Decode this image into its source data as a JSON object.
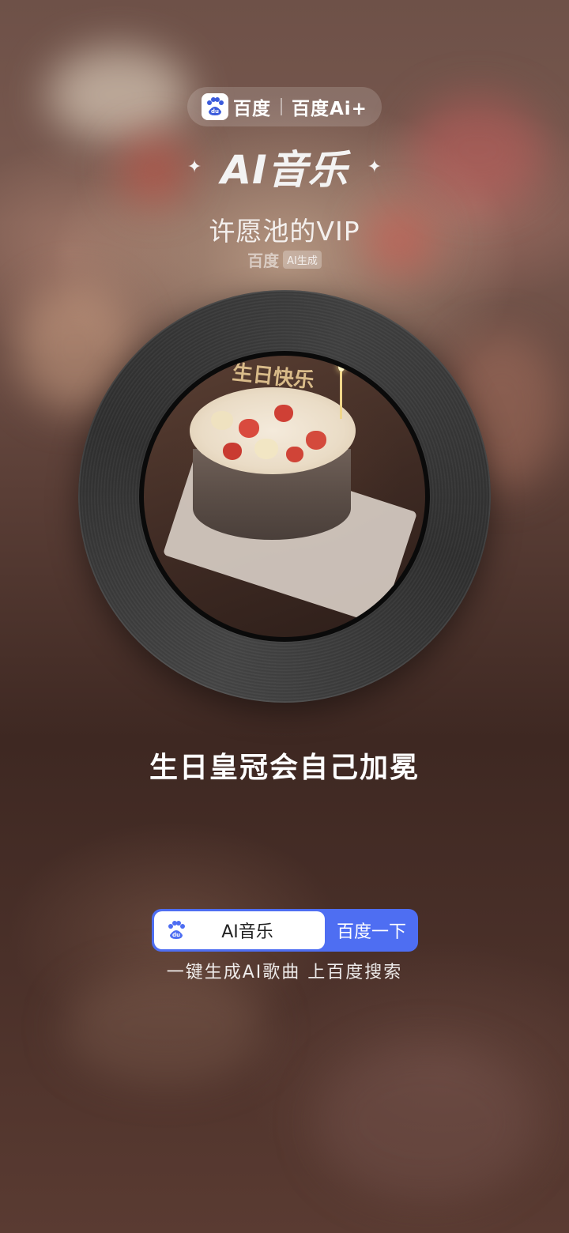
{
  "header": {
    "brand_name": "百度",
    "brand_ai": "百度Ai+",
    "logo_icon": "baidu-paw-icon"
  },
  "app": {
    "title": "AI音乐",
    "sparkle_left": "✦",
    "sparkle_right": "✦"
  },
  "song": {
    "title": "许愿池的VIP",
    "source_brand": "百度",
    "source_badge": "AI生成",
    "cover_script": "生日快乐"
  },
  "lyric": {
    "current_line": "生日皇冠会自己加冕"
  },
  "search": {
    "logo_icon": "baidu-paw-icon",
    "query": "AI音乐",
    "button_label": "百度一下",
    "tagline": "一键生成AI歌曲 上百度搜索"
  },
  "colors": {
    "search_blue": "#4e6ef2",
    "vinyl": "#2f2f2f"
  }
}
